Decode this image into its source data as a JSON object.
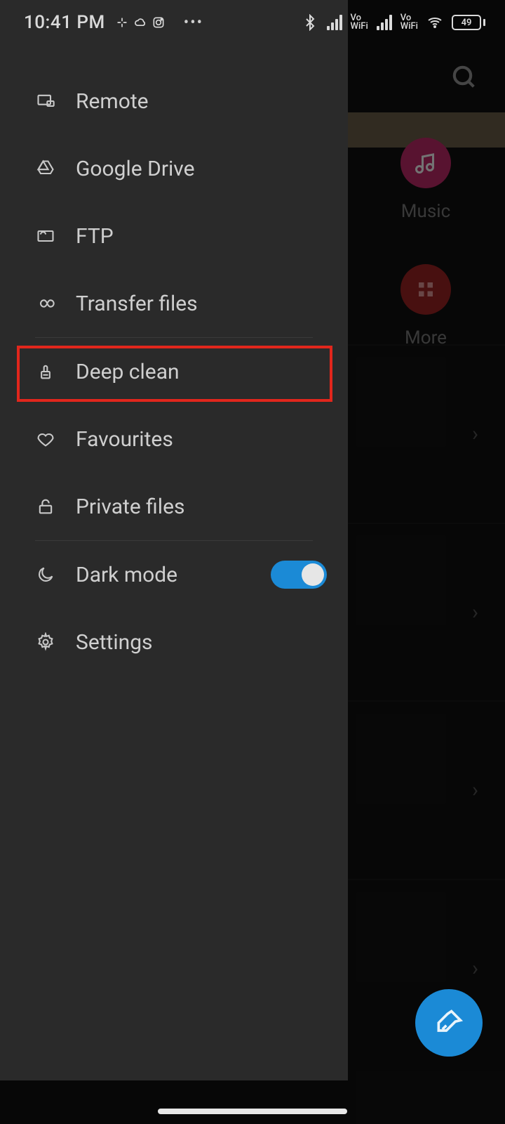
{
  "status": {
    "time": "10:41 PM",
    "battery": "49",
    "vowifi": "Vo\nWiFi"
  },
  "drawer": {
    "items": [
      {
        "id": "remote",
        "label": "Remote",
        "icon": "monitor"
      },
      {
        "id": "google-drive",
        "label": "Google Drive",
        "icon": "drive"
      },
      {
        "id": "ftp",
        "label": "FTP",
        "icon": "ftp"
      },
      {
        "id": "transfer",
        "label": "Transfer files",
        "icon": "infinity"
      },
      {
        "id": "deep-clean",
        "label": "Deep clean",
        "icon": "broom"
      },
      {
        "id": "favourites",
        "label": "Favourites",
        "icon": "heart"
      },
      {
        "id": "private",
        "label": "Private files",
        "icon": "lock"
      },
      {
        "id": "dark-mode",
        "label": "Dark mode",
        "icon": "moon",
        "toggle": true,
        "enabled": true
      },
      {
        "id": "settings",
        "label": "Settings",
        "icon": "gear"
      }
    ],
    "highlighted_id": "deep-clean"
  },
  "background": {
    "tiles": [
      {
        "id": "music",
        "label": "Music"
      },
      {
        "id": "more",
        "label": "More"
      }
    ]
  },
  "colors": {
    "drawer_bg": "#2a2a2a",
    "accent": "#1b8ad6",
    "highlight": "#e1261c",
    "music_tile": "#c32a6b",
    "more_tile": "#a02424"
  }
}
